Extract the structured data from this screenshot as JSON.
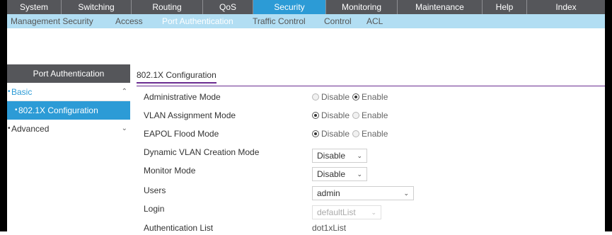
{
  "top_nav": {
    "tabs": [
      {
        "label": "System"
      },
      {
        "label": "Switching"
      },
      {
        "label": "Routing"
      },
      {
        "label": "QoS"
      },
      {
        "label": "Security"
      },
      {
        "label": "Monitoring"
      },
      {
        "label": "Maintenance"
      },
      {
        "label": "Help"
      },
      {
        "label": "Index"
      }
    ],
    "active": "Security"
  },
  "sub_nav": {
    "items": [
      {
        "label": "Management Security"
      },
      {
        "label": "Access"
      },
      {
        "label": "Port Authentication"
      },
      {
        "label": "Traffic Control"
      },
      {
        "label": "Control"
      },
      {
        "label": "ACL"
      }
    ],
    "active": "Port Authentication"
  },
  "sidebar": {
    "header": "Port Authentication",
    "basic": "Basic",
    "basic_item": "802.1X Configuration",
    "advanced": "Advanced",
    "bullet": "•",
    "chevron_up": "⌃",
    "chevron_down": "⌄"
  },
  "content": {
    "tab_label": "802.1X Configuration",
    "fields": {
      "admin_mode": {
        "label": "Administrative Mode",
        "disable": "Disable",
        "enable": "Enable",
        "selected": "Enable"
      },
      "vlan_assign": {
        "label": "VLAN Assignment Mode",
        "disable": "Disable",
        "enable": "Enable",
        "selected": "Disable"
      },
      "eapol_flood": {
        "label": "EAPOL Flood Mode",
        "disable": "Disable",
        "enable": "Enable",
        "selected": "Disable"
      },
      "dyn_vlan": {
        "label": "Dynamic VLAN Creation Mode",
        "value": "Disable"
      },
      "monitor": {
        "label": "Monitor Mode",
        "value": "Disable"
      },
      "users": {
        "label": "Users",
        "value": "admin"
      },
      "login": {
        "label": "Login",
        "value": "defaultList"
      },
      "auth_list": {
        "label": "Authentication List",
        "value": "dot1xList"
      }
    }
  },
  "colors": {
    "accent": "#2c9bd6",
    "nav_bg": "#55565a",
    "subnav_bg": "#b2def3",
    "tab_underline": "#6a2c91"
  }
}
